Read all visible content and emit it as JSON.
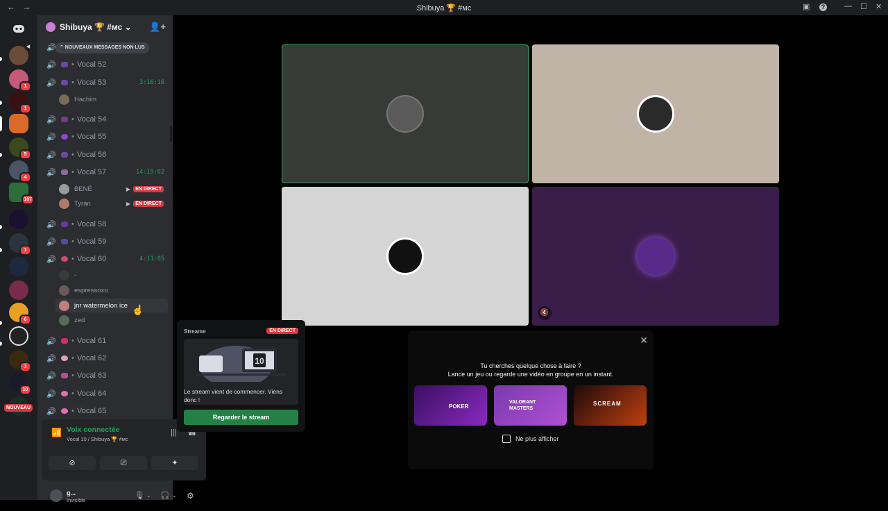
{
  "titlebar": {
    "back": "←",
    "forward": "→",
    "title": "Shibuya 🏆 #мс",
    "screen_icon": "▣",
    "help_icon": "?",
    "minimize": "—",
    "maximize": "☐",
    "close": "✕"
  },
  "server": {
    "name": "Shibuya 🏆 #мс ⌄",
    "invite_icon": "👤+",
    "unread_pill": "⌃ NOUVEAUX MESSAGES NON LUS"
  },
  "guilds": {
    "badges": [
      "1",
      "1",
      "5",
      "4",
      "107",
      "1",
      "6",
      "1",
      "10"
    ],
    "new_label": "NOUVEAU"
  },
  "channels": {
    "vol_icon": "🔊",
    "dot": "•",
    "items": [
      {
        "name": "Vocal 52"
      },
      {
        "name": "Vocal 53",
        "timer": "3:16:16"
      },
      {
        "name": "Vocal 54"
      },
      {
        "name": "Vocal 55"
      },
      {
        "name": "Vocal 56"
      },
      {
        "name": "Vocal 57",
        "timer": "14:19:02"
      },
      {
        "name": "Vocal 58"
      },
      {
        "name": "Vocal 59"
      },
      {
        "name": "Vocal 60",
        "timer": "4:11:05"
      },
      {
        "name": "Vocal 61"
      },
      {
        "name": "Vocal 62"
      },
      {
        "name": "Vocal 63"
      },
      {
        "name": "Vocal 64"
      },
      {
        "name": "Vocal 65"
      }
    ],
    "members": {
      "vocal53": [
        "Hachim"
      ],
      "vocal57": [
        "BENÉ",
        "Tyran"
      ],
      "vocal60": [
        "-",
        "espressoxo",
        "jnr watermelon ice",
        "zed"
      ]
    },
    "live_label": "EN DIRECT",
    "camera_icon": "▶"
  },
  "voice_panel": {
    "status": "Voix connectée",
    "channel": "Vocal 10 / Shibuya 🏆 #мс",
    "signal_icon": "📶",
    "soundboard_icon": "|||",
    "disconnect_icon": "☎",
    "camera_off_icon": "⊘",
    "screen_share_icon": "⎚",
    "activity_icon": "✦"
  },
  "user": {
    "name": "g...",
    "status": "Invisible",
    "mic_icon": "🎙",
    "headset_icon": "🎧",
    "settings_icon": "⚙",
    "chevron": "⌄"
  },
  "tiles": {
    "mute_icon": "🔇"
  },
  "stream_popup": {
    "label": "Streame",
    "live": "EN DIRECT",
    "message": "Le stream vient de commencer. Viens donc !",
    "button": "Regarder le stream",
    "illustration_number": "10"
  },
  "activity": {
    "close": "✕",
    "line1": "Tu cherches quelque chose à faire ?",
    "line2": "Lance un jeu ou regarde une vidéo en groupe en un instant.",
    "cards": [
      "POKER",
      "VALORANT MASTERS",
      "SCREAM"
    ],
    "checkbox_label": "Ne plus afficher"
  },
  "colors": {
    "accent_green": "#23a55a",
    "live_red": "#da373c",
    "button_green": "#248046"
  }
}
